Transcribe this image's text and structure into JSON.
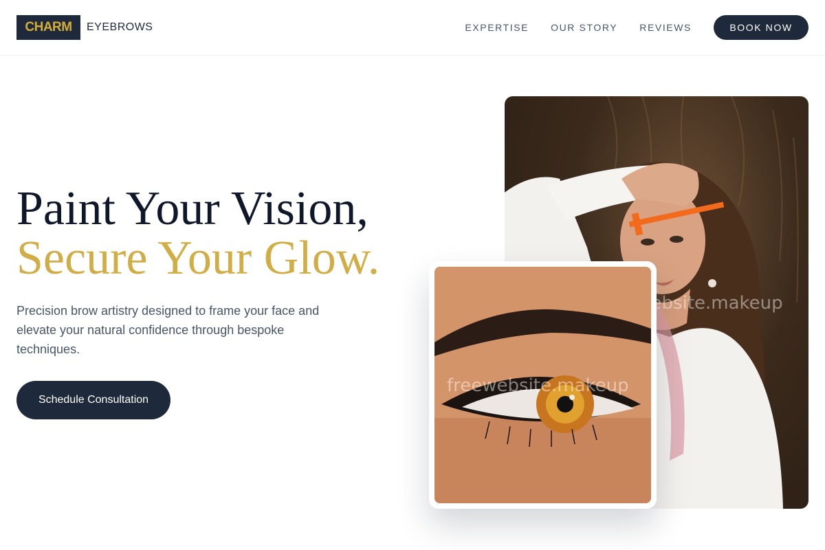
{
  "brand": {
    "name_highlight": "CHARM",
    "name_rest": "EYEBROWS"
  },
  "nav": {
    "items": [
      {
        "label": "EXPERTISE"
      },
      {
        "label": "OUR STORY"
      },
      {
        "label": "REVIEWS"
      }
    ],
    "book_label": "BOOK NOW"
  },
  "hero": {
    "title_line1": "Paint Your Vision,",
    "title_line2": "Secure Your Glow.",
    "description": "Precision brow artistry designed to frame your face and elevate your natural confidence through bespoke techniques.",
    "cta_label": "Schedule Consultation"
  },
  "images": {
    "main_watermark": "freewebsite.makeup",
    "eye_watermark": "freewebsite.makeup"
  },
  "colors": {
    "navy": "#1e293b",
    "gold": "#d1ad45"
  }
}
